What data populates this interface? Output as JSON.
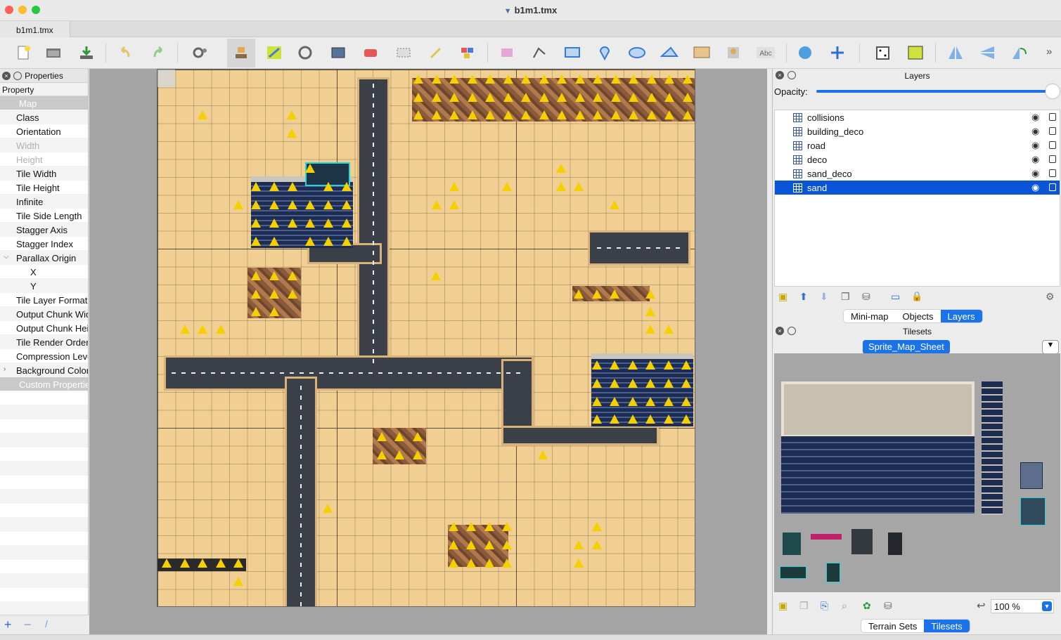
{
  "window": {
    "title": "b1m1.tmx"
  },
  "document_tab": {
    "label": "b1m1.tmx"
  },
  "toolbar": {
    "icons": [
      "new-icon",
      "open-icon",
      "save-icon",
      "undo-icon",
      "redo-icon",
      "command-icon",
      "stamp-brush-icon",
      "terrain-brush-icon",
      "wang-brush-icon",
      "bucket-fill-icon",
      "shape-fill-icon",
      "eraser-icon",
      "rectangular-select-icon",
      "magic-wand-icon",
      "select-same-tile-icon",
      "select-objects-icon",
      "edit-polygons-icon",
      "insert-rectangle-icon",
      "insert-point-icon",
      "insert-ellipse-icon",
      "insert-polygon-icon",
      "insert-tile-icon",
      "insert-template-icon",
      "insert-text-icon",
      "world-tool-icon",
      "offset-map-icon",
      "random-mode-icon",
      "wang-fill-icon",
      "flip-horizontal-icon",
      "flip-vertical-icon",
      "rotate-icon",
      "more-icon"
    ]
  },
  "properties": {
    "panel_title": "Properties",
    "column_header": "Property",
    "rows": [
      {
        "label": "Map",
        "kind": "group"
      },
      {
        "label": "Class",
        "kind": "normal"
      },
      {
        "label": "Orientation",
        "kind": "normal"
      },
      {
        "label": "Width",
        "kind": "disabled"
      },
      {
        "label": "Height",
        "kind": "disabled"
      },
      {
        "label": "Tile Width",
        "kind": "normal"
      },
      {
        "label": "Tile Height",
        "kind": "normal"
      },
      {
        "label": "Infinite",
        "kind": "normal"
      },
      {
        "label": "Tile Side Length",
        "kind": "normal"
      },
      {
        "label": "Stagger Axis",
        "kind": "normal"
      },
      {
        "label": "Stagger Index",
        "kind": "normal"
      },
      {
        "label": "Parallax Origin",
        "kind": "expanded"
      },
      {
        "label": "X",
        "kind": "child"
      },
      {
        "label": "Y",
        "kind": "child"
      },
      {
        "label": "Tile Layer Format",
        "kind": "normal"
      },
      {
        "label": "Output Chunk Width",
        "kind": "normal"
      },
      {
        "label": "Output Chunk Height",
        "kind": "normal"
      },
      {
        "label": "Tile Render Order",
        "kind": "normal"
      },
      {
        "label": "Compression Level",
        "kind": "normal"
      },
      {
        "label": "Background Color",
        "kind": "collapsed"
      },
      {
        "label": "Custom Properties",
        "kind": "group"
      }
    ],
    "bottom_icons": [
      "add-property-icon",
      "remove-property-icon",
      "rename-property-icon"
    ]
  },
  "layers_panel": {
    "title": "Layers",
    "opacity_label": "Opacity:",
    "opacity": 1.0,
    "layers": [
      {
        "name": "collisions",
        "selected": false
      },
      {
        "name": "building_deco",
        "selected": false
      },
      {
        "name": "road",
        "selected": false
      },
      {
        "name": "deco",
        "selected": false
      },
      {
        "name": "sand_deco",
        "selected": false
      },
      {
        "name": "sand",
        "selected": true
      }
    ],
    "tabs": [
      {
        "label": "Mini-map",
        "active": false
      },
      {
        "label": "Objects",
        "active": false
      },
      {
        "label": "Layers",
        "active": true
      }
    ]
  },
  "tilesets_panel": {
    "title": "Tilesets",
    "current_tileset": "Sprite_Map_Sheet",
    "zoom": "100 %",
    "tabs": [
      {
        "label": "Terrain Sets",
        "active": false
      },
      {
        "label": "Tilesets",
        "active": true
      }
    ]
  },
  "colors": {
    "accent": "#1a73e8",
    "selection": "#0a55d6",
    "sand": "#f1cf92",
    "road": "#3b3f47"
  }
}
